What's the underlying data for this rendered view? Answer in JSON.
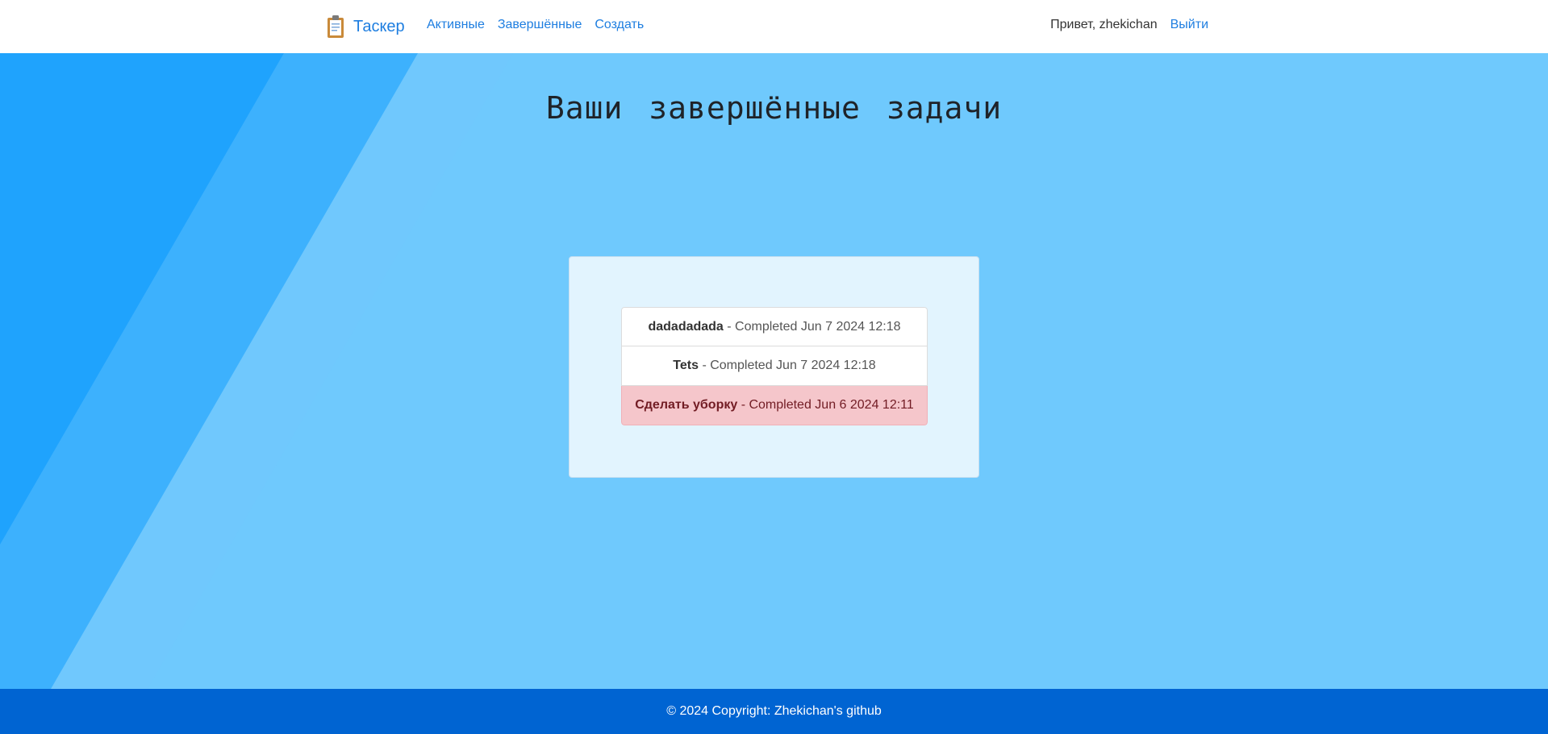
{
  "navbar": {
    "brand": "Таскер",
    "brand_icon": "clipboard-icon",
    "links": {
      "active": "Активные",
      "completed": "Завершённые",
      "create": "Создать"
    },
    "greeting": "Привет, zhekichan",
    "logout": "Выйти"
  },
  "page": {
    "title": "Ваши завершённые задачи"
  },
  "tasks": [
    {
      "name": "dadadadada",
      "separator": " - ",
      "status": "Completed Jun 7 2024 12:18",
      "highlight": false
    },
    {
      "name": "Tets",
      "separator": " - ",
      "status": "Completed Jun 7 2024 12:18",
      "highlight": false
    },
    {
      "name": "Сделать уборку",
      "separator": " - ",
      "status": "Completed Jun 6 2024 12:11",
      "highlight": true
    }
  ],
  "footer": {
    "text": "© 2024 Copyright: Zhekichan's github"
  },
  "colors": {
    "accent": "#1e7ee0",
    "background": "#6fc9fd",
    "footer": "#0064d2",
    "danger_bg": "#f5c6cb"
  }
}
